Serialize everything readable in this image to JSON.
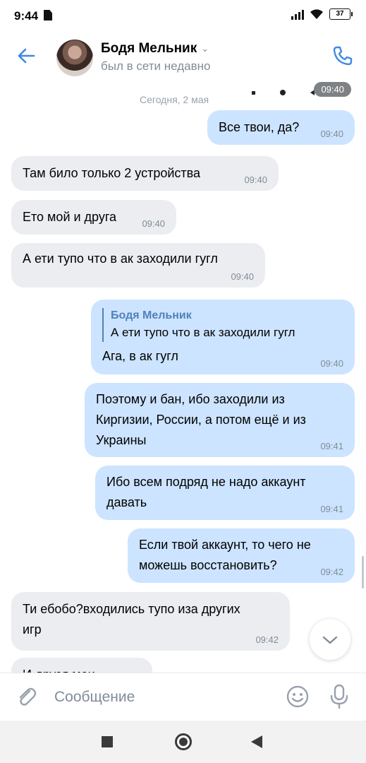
{
  "status": {
    "time": "9:44",
    "battery": "37"
  },
  "header": {
    "name": "Бодя Мельник",
    "subtitle": "был в сети недавно"
  },
  "chat": {
    "date_divider": "Сегодня, 2 мая",
    "overlay_time": "09:40",
    "messages": [
      {
        "dir": "out",
        "text": "Все твои, да?",
        "time": "09:40"
      },
      {
        "dir": "in",
        "text": "Там било только 2 устройства",
        "time": "09:40"
      },
      {
        "dir": "in",
        "text": "Ето мой и друга",
        "time": "09:40"
      },
      {
        "dir": "in",
        "text": "А ети тупо что в ак заходили гугл",
        "time": "09:40"
      },
      {
        "dir": "out",
        "reply_name": "Бодя Мельник",
        "reply_text": "А ети тупо что в ак заходили гугл",
        "text": "Ага, в ак гугл",
        "time": "09:40"
      },
      {
        "dir": "out",
        "text": "Поэтому и бан, ибо заходили из\nКиргизии, России, а потом ещё и из\nУкраины",
        "time": "09:41"
      },
      {
        "dir": "out",
        "text": "Ибо всем подряд не надо аккаунт\nдавать",
        "time": "09:41"
      },
      {
        "dir": "out",
        "text": "Если твой аккаунт, то чего не\nможешь восстановить?",
        "time": "09:42"
      },
      {
        "dir": "in",
        "text": "Ти ебобо?входились тупо иза других\nигр",
        "time": "09:42"
      },
      {
        "dir": "in",
        "text": "И друзя мои",
        "time": ""
      }
    ]
  },
  "input": {
    "placeholder": "Сообщение"
  },
  "icons": {
    "back": "arrow-left-icon",
    "call": "phone-icon",
    "attach": "paperclip-icon",
    "emoji": "smile-icon",
    "mic": "microphone-icon",
    "scroll_down": "chevron-down-icon"
  },
  "colors": {
    "accent": "#3f8ae0",
    "outgoing": "#cce4ff",
    "incoming": "#ebedf0"
  }
}
